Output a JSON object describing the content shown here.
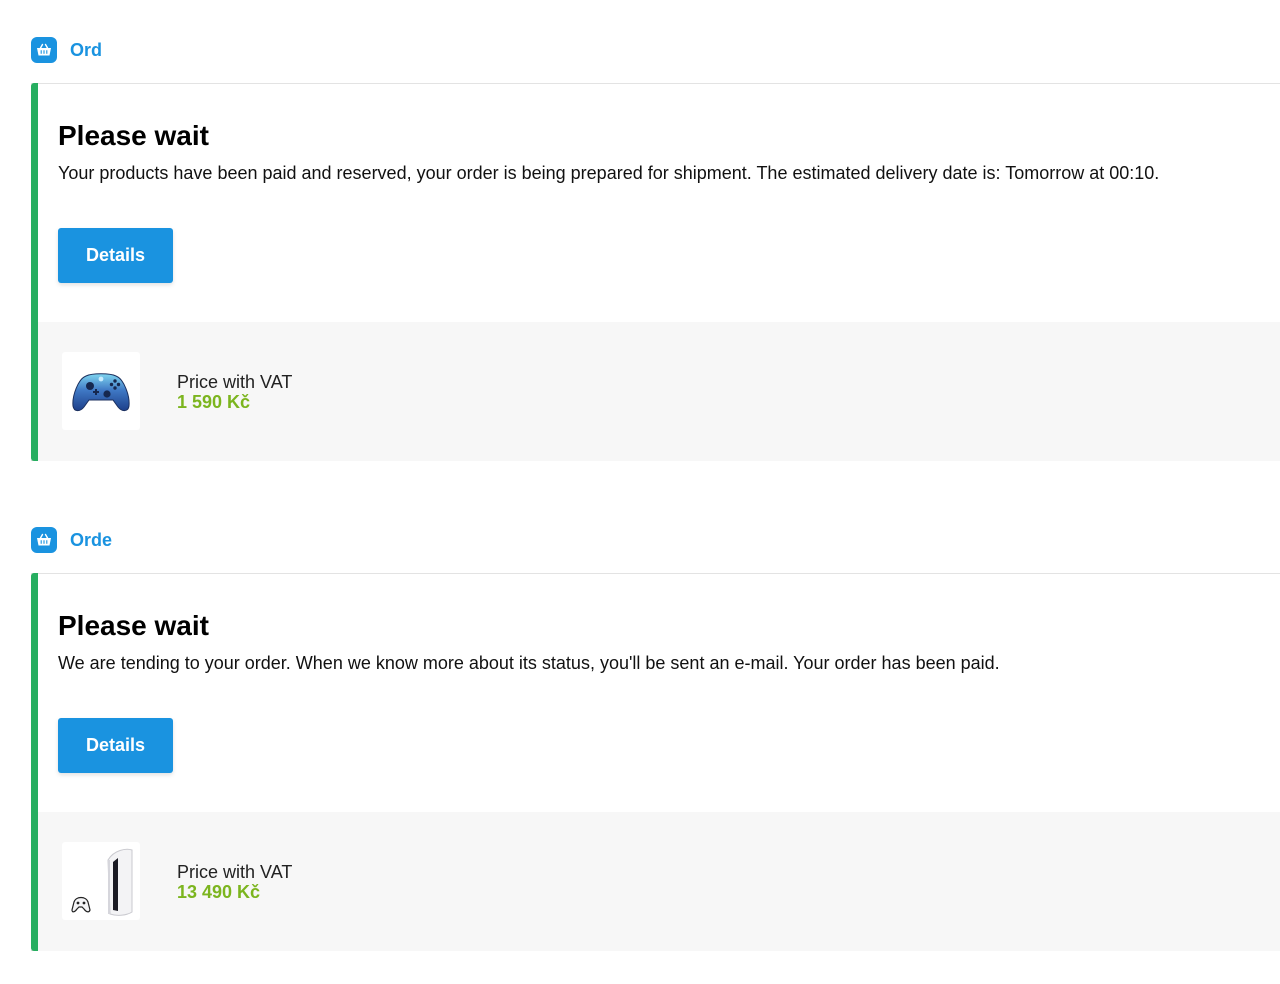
{
  "orders": [
    {
      "header_label": "Ord",
      "status_title": "Please wait",
      "status_message": "Your products have been paid and reserved, your order is being prepared for shipment. The estimated delivery date is: Tomorrow at 00:10.",
      "details_label": "Details",
      "product": {
        "image_icon": "game-controller",
        "price_label": "Price with VAT",
        "price_value": "1 590 Kč"
      }
    },
    {
      "header_label": "Orde",
      "status_title": "Please wait",
      "status_message": "We are tending to your order. When we know more about its status, you'll be sent an e-mail. Your order has been paid.",
      "details_label": "Details",
      "product": {
        "image_icon": "game-console",
        "price_label": "Price with VAT",
        "price_value": "13 490 Kč"
      }
    }
  ],
  "colors": {
    "accent_blue": "#1a93e0",
    "status_green": "#27ae60",
    "price_green": "#7cb51f",
    "product_bg": "#f7f7f7"
  }
}
